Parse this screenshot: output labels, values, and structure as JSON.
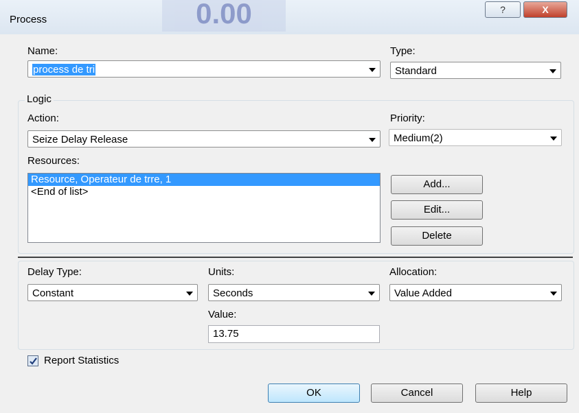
{
  "window": {
    "title": "Process",
    "bg_title": "0.00",
    "help_glyph": "?",
    "close_glyph": "X"
  },
  "name": {
    "label": "Name:",
    "value": "process de tri"
  },
  "type": {
    "label": "Type:",
    "value": "Standard"
  },
  "logic": {
    "group_label": "Logic",
    "action_label": "Action:",
    "action_value": "Seize Delay Release",
    "priority_label": "Priority:",
    "priority_value": "Medium(2)",
    "resources_label": "Resources:",
    "resources": [
      "Resource, Operateur de trre, 1",
      "<End of list>"
    ],
    "add_button": "Add...",
    "edit_button": "Edit...",
    "delete_button": "Delete"
  },
  "delay": {
    "delay_type_label": "Delay Type:",
    "delay_type_value": "Constant",
    "units_label": "Units:",
    "units_value": "Seconds",
    "allocation_label": "Allocation:",
    "allocation_value": "Value Added",
    "value_label": "Value:",
    "value_value": "13.75"
  },
  "report_statistics": {
    "label": "Report Statistics",
    "checked": true
  },
  "buttons": {
    "ok": "OK",
    "cancel": "Cancel",
    "help": "Help"
  },
  "colors": {
    "selection": "#3399ff",
    "dialog_bg": "#f0f0f0",
    "close_red": "#c0412c"
  }
}
